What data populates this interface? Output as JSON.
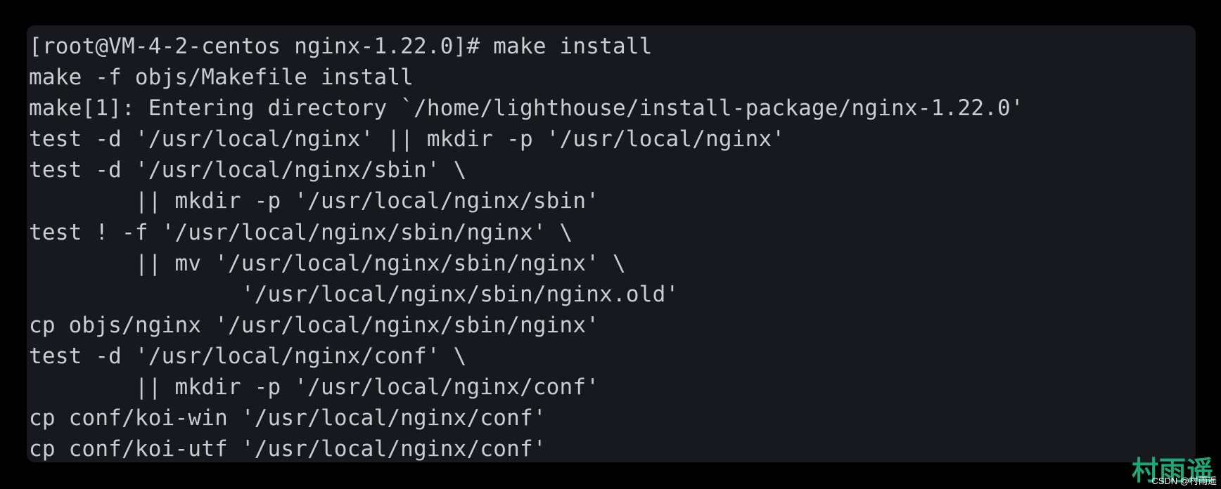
{
  "terminal": {
    "lines": [
      "[root@VM-4-2-centos nginx-1.22.0]# make install",
      "make -f objs/Makefile install",
      "make[1]: Entering directory `/home/lighthouse/install-package/nginx-1.22.0'",
      "test -d '/usr/local/nginx' || mkdir -p '/usr/local/nginx'",
      "test -d '/usr/local/nginx/sbin' \\",
      "        || mkdir -p '/usr/local/nginx/sbin'",
      "test ! -f '/usr/local/nginx/sbin/nginx' \\",
      "        || mv '/usr/local/nginx/sbin/nginx' \\",
      "                '/usr/local/nginx/sbin/nginx.old'",
      "cp objs/nginx '/usr/local/nginx/sbin/nginx'",
      "test -d '/usr/local/nginx/conf' \\",
      "        || mkdir -p '/usr/local/nginx/conf'",
      "cp conf/koi-win '/usr/local/nginx/conf'",
      "cp conf/koi-utf '/usr/local/nginx/conf'"
    ]
  },
  "watermark": {
    "text": "村雨遥",
    "subtext": "CSDN @村雨遥"
  },
  "colors": {
    "terminal_background": "#17191e",
    "terminal_text": "#c9ccd1",
    "watermark": "#1fa67a"
  }
}
